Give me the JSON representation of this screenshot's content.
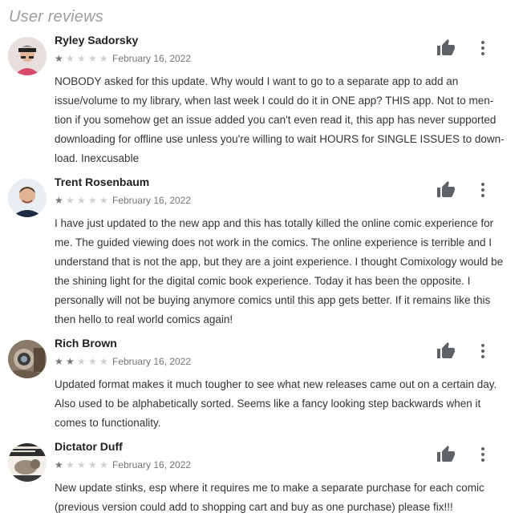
{
  "section_title": "User reviews",
  "colors": {
    "star_filled": "#757575",
    "star_empty": "#d0d0d0",
    "icon": "#5f6368",
    "title": "#9e9e9e"
  },
  "reviews": [
    {
      "author": "Ryley Sadorsky",
      "rating": 1,
      "max_rating": 5,
      "date": "February 16, 2022",
      "text": "NOBODY asked for this update. Why would I want to go to a separate app to add an issue/volume to my library, when last week I could do it in ONE app? THIS app. Not to men-tion if you somehow get an issue added you can't even read it, this app has never supported downloading for offline use unless you're willing to wait HOURS for SINGLE ISSUES to down-load. Inexcusable",
      "like_icon": "thumb-up-icon",
      "more_icon": "more-vert-icon"
    },
    {
      "author": "Trent Rosenbaum",
      "rating": 1,
      "max_rating": 5,
      "date": "February 16, 2022",
      "text": "I have just updated to the new app and this has totally killed the online comic experience for me. The guided viewing does not work in the comics. The online experience is terrible and I understand that is not the app, but they are a joint experience. I thought Comixology would be the shining light for the digital comic book experience. Today it has been the opposite. I personally will not be buying anymore comics until this app gets better. If it remains like this then hello to real world comics again!",
      "like_icon": "thumb-up-icon",
      "more_icon": "more-vert-icon"
    },
    {
      "author": "Rich Brown",
      "rating": 2,
      "max_rating": 5,
      "date": "February 16, 2022",
      "text": "Updated format makes it much tougher to see what new releases came out on a certain day. Also used to be alphabetically sorted. Seems like a fancy looking step backwards when it comes to functionality.",
      "like_icon": "thumb-up-icon",
      "more_icon": "more-vert-icon"
    },
    {
      "author": "Dictator Duff",
      "rating": 1,
      "max_rating": 5,
      "date": "February 16, 2022",
      "text": "New update stinks, esp where it requires me to make a separate purchase for each comic (previous version could add to shopping cart and buy as one purchase) please fix!!!",
      "like_icon": "thumb-up-icon",
      "more_icon": "more-vert-icon"
    }
  ]
}
